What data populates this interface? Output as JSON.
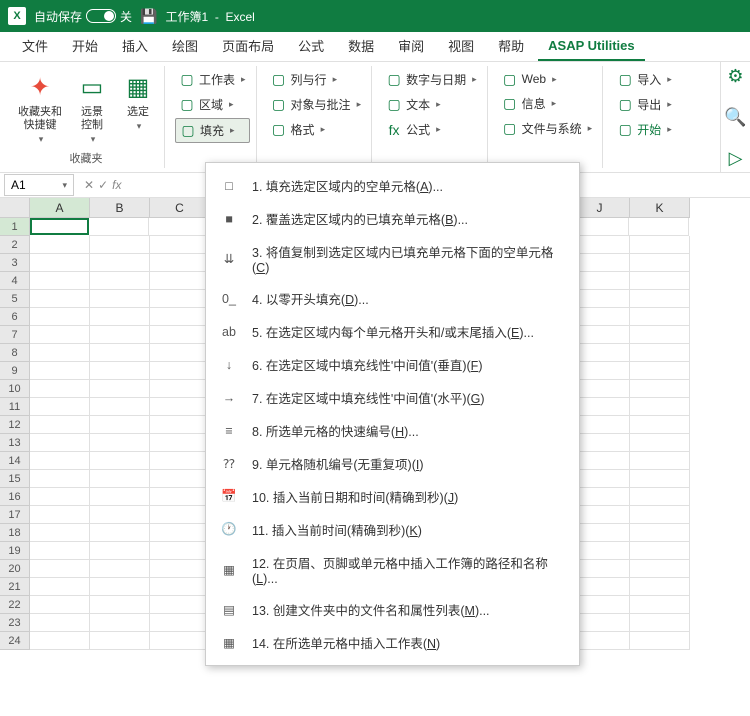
{
  "title": {
    "autosave": "自动保存",
    "autosave_state": "关",
    "workbook": "工作簿1",
    "app": "Excel"
  },
  "tabs": [
    "文件",
    "开始",
    "插入",
    "绘图",
    "页面布局",
    "公式",
    "数据",
    "审阅",
    "视图",
    "帮助",
    "ASAP Utilities"
  ],
  "active_tab": 10,
  "ribbon": {
    "fav_big": "收藏夹和\n快捷键",
    "vision": "远景\n控制",
    "select": "选定",
    "group1_label": "收藏夹",
    "col2": [
      {
        "t": "工作表"
      },
      {
        "t": "区域"
      },
      {
        "t": "填充",
        "active": true
      }
    ],
    "col3": [
      {
        "t": "列与行"
      },
      {
        "t": "对象与批注"
      },
      {
        "t": "格式"
      }
    ],
    "col4": [
      {
        "t": "数字与日期"
      },
      {
        "t": "文本"
      },
      {
        "t": "公式",
        "prefix": "fx"
      }
    ],
    "col5": [
      {
        "t": "Web"
      },
      {
        "t": "信息"
      },
      {
        "t": "文件与系统"
      }
    ],
    "col6": [
      {
        "t": "导入"
      },
      {
        "t": "导出"
      },
      {
        "t": "开始",
        "green": true
      }
    ]
  },
  "name_box": "A1",
  "columns": [
    "A",
    "B",
    "C",
    "",
    "",
    "",
    "",
    "",
    "",
    "J",
    "K"
  ],
  "row_count": 24,
  "dropdown": [
    {
      "n": "1.",
      "t": "填充选定区域内的空单元格(",
      "u": "A",
      "s": ")..."
    },
    {
      "n": "2.",
      "t": "覆盖选定区域内的已填充单元格(",
      "u": "B",
      "s": ")..."
    },
    {
      "n": "3.",
      "t": "将值复制到选定区域内已填充单元格下面的空单元格(",
      "u": "C",
      "s": ")"
    },
    {
      "n": "4.",
      "t": "以零开头填充(",
      "u": "D",
      "s": ")..."
    },
    {
      "n": "5.",
      "t": "在选定区域内每个单元格开头和/或末尾插入(",
      "u": "E",
      "s": ")..."
    },
    {
      "n": "6.",
      "t": "在选定区域中填充线性'中间值'(垂直)(",
      "u": "F",
      "s": ")"
    },
    {
      "n": "7.",
      "t": "在选定区域中填充线性'中间值'(水平)(",
      "u": "G",
      "s": ")"
    },
    {
      "n": "8.",
      "t": "所选单元格的快速编号(",
      "u": "H",
      "s": ")..."
    },
    {
      "n": "9.",
      "t": "单元格随机编号(无重复项)(",
      "u": "I",
      "s": ")"
    },
    {
      "n": "10.",
      "t": "插入当前日期和时间(精确到秒)(",
      "u": "J",
      "s": ")"
    },
    {
      "n": "11.",
      "t": "插入当前时间(精确到秒)(",
      "u": "K",
      "s": ")"
    },
    {
      "n": "12.",
      "t": "在页眉、页脚或单元格中插入工作簿的路径和名称(",
      "u": "L",
      "s": ")..."
    },
    {
      "n": "13.",
      "t": "创建文件夹中的文件名和属性列表(",
      "u": "M",
      "s": ")..."
    },
    {
      "n": "14.",
      "t": "在所选单元格中插入工作表(",
      "u": "N",
      "s": ")"
    }
  ],
  "dd_icons": [
    "□",
    "■",
    "⇊",
    "0_",
    "ab",
    "↓",
    "→",
    "≡",
    "⁇",
    "📅",
    "🕐",
    "▦",
    "▤",
    "▦"
  ]
}
